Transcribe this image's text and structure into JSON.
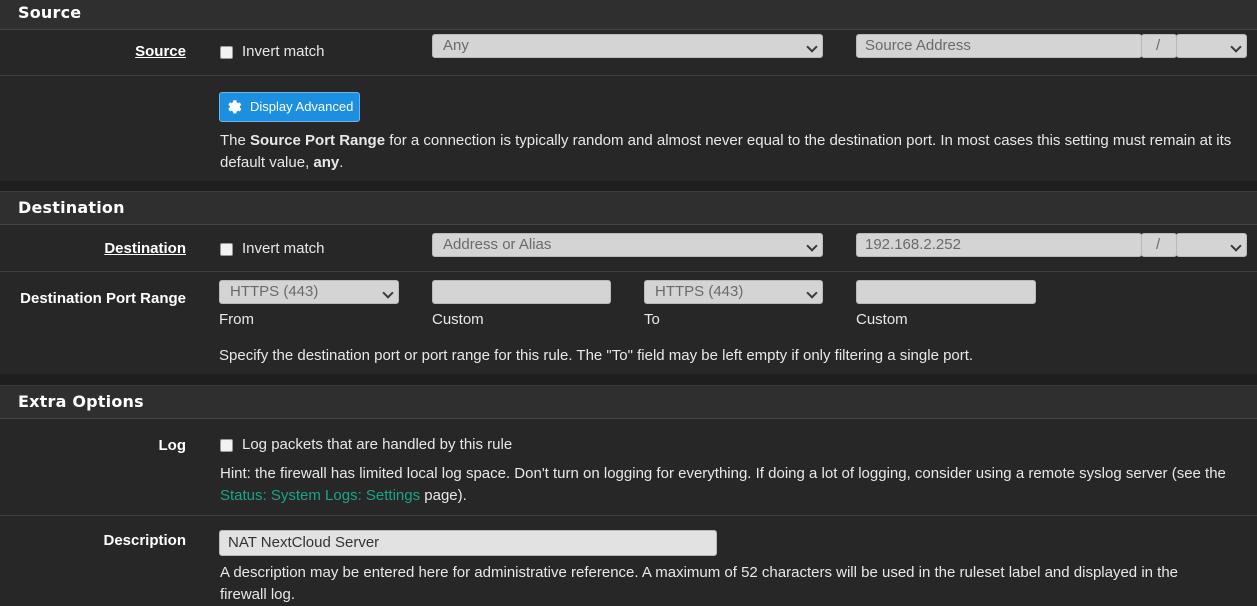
{
  "source": {
    "heading": "Source",
    "label": "Source",
    "invert_label": "Invert match",
    "type_value": "Any",
    "address_placeholder": "Source Address",
    "slash": "/",
    "advanced_button": "Display Advanced",
    "help_pre": "The ",
    "help_bold": "Source Port Range",
    "help_mid": " for a connection is typically random and almost never equal to the destination port. In most cases this setting must remain at its default value, ",
    "help_any": "any",
    "help_end": "."
  },
  "destination": {
    "heading": "Destination",
    "label": "Destination",
    "invert_label": "Invert match",
    "type_value": "Address or Alias",
    "address_value": "192.168.2.252",
    "slash": "/",
    "port_label": "Destination Port Range",
    "from_value": "HTTPS (443)",
    "to_value": "HTTPS (443)",
    "from_caption": "From",
    "custom_caption_1": "Custom",
    "to_caption": "To",
    "custom_caption_2": "Custom",
    "help": "Specify the destination port or port range for this rule. The \"To\" field may be left empty if only filtering a single port."
  },
  "extra": {
    "heading": "Extra Options",
    "log_label": "Log",
    "log_checkbox_label": "Log packets that are handled by this rule",
    "hint_pre": "Hint: the firewall has limited local log space. Don't turn on logging for everything. If doing a lot of logging, consider using a remote syslog server (see the ",
    "hint_link": "Status: System Logs: Settings",
    "hint_post": " page).",
    "description_label": "Description",
    "description_value": "NAT NextCloud Server",
    "description_help": "A description may be entered here for administrative reference. A maximum of 52 characters will be used in the ruleset label and displayed in the firewall log."
  },
  "colors": {
    "accent_button": "#1c8fe0",
    "link": "#19a58b"
  }
}
